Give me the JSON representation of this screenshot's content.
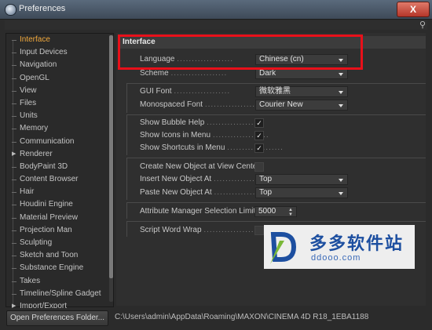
{
  "window": {
    "title": "Preferences",
    "close_label": "X"
  },
  "sidebar": {
    "items": [
      {
        "label": "Interface"
      },
      {
        "label": "Input Devices"
      },
      {
        "label": "Navigation"
      },
      {
        "label": "OpenGL"
      },
      {
        "label": "View"
      },
      {
        "label": "Files"
      },
      {
        "label": "Units"
      },
      {
        "label": "Memory"
      },
      {
        "label": "Communication"
      },
      {
        "label": "Renderer"
      },
      {
        "label": "BodyPaint 3D"
      },
      {
        "label": "Content Browser"
      },
      {
        "label": "Hair"
      },
      {
        "label": "Houdini Engine"
      },
      {
        "label": "Material Preview"
      },
      {
        "label": "Projection Man"
      },
      {
        "label": "Sculpting"
      },
      {
        "label": "Sketch and Toon"
      },
      {
        "label": "Substance Engine"
      },
      {
        "label": "Takes"
      },
      {
        "label": "Timeline/Spline Gadget"
      },
      {
        "label": "Import/Export"
      }
    ],
    "active": "Interface"
  },
  "content": {
    "section_title": "Interface",
    "language": {
      "label": "Language",
      "value": "Chinese (cn)"
    },
    "scheme": {
      "label": "Scheme",
      "value": "Dark"
    },
    "gui_font": {
      "label": "GUI Font",
      "value": "微软雅黑"
    },
    "mono_font": {
      "label": "Monospaced Font",
      "value": "Courier New"
    },
    "bubble_help": {
      "label": "Show Bubble Help",
      "checked": true
    },
    "icons_in_menu": {
      "label": "Show Icons in Menu",
      "checked": true
    },
    "shortcuts_in_menu": {
      "label": "Show Shortcuts in Menu",
      "checked": true
    },
    "new_object_center": {
      "label": "Create New Object at View Center",
      "checked": false
    },
    "insert_new_object": {
      "label": "Insert New Object At",
      "value": "Top"
    },
    "paste_new_object": {
      "label": "Paste New Object At",
      "value": "Top"
    },
    "attr_manager_limit": {
      "label": "Attribute Manager Selection Limit",
      "value": "5000"
    },
    "script_word_wrap": {
      "label": "Script Word Wrap",
      "checked": false
    },
    "dots": "..................."
  },
  "watermark": {
    "cn": "多多软件站",
    "url": "ddooo.com"
  },
  "footer": {
    "open_button": "Open Preferences Folder...",
    "path": "C:\\Users\\admin\\AppData\\Roaming\\MAXON\\CINEMA 4D R18_1EBA1188"
  },
  "colors": {
    "accent": "#f0a83c",
    "highlight": "#e8101a",
    "background": "#2b2b2b"
  }
}
